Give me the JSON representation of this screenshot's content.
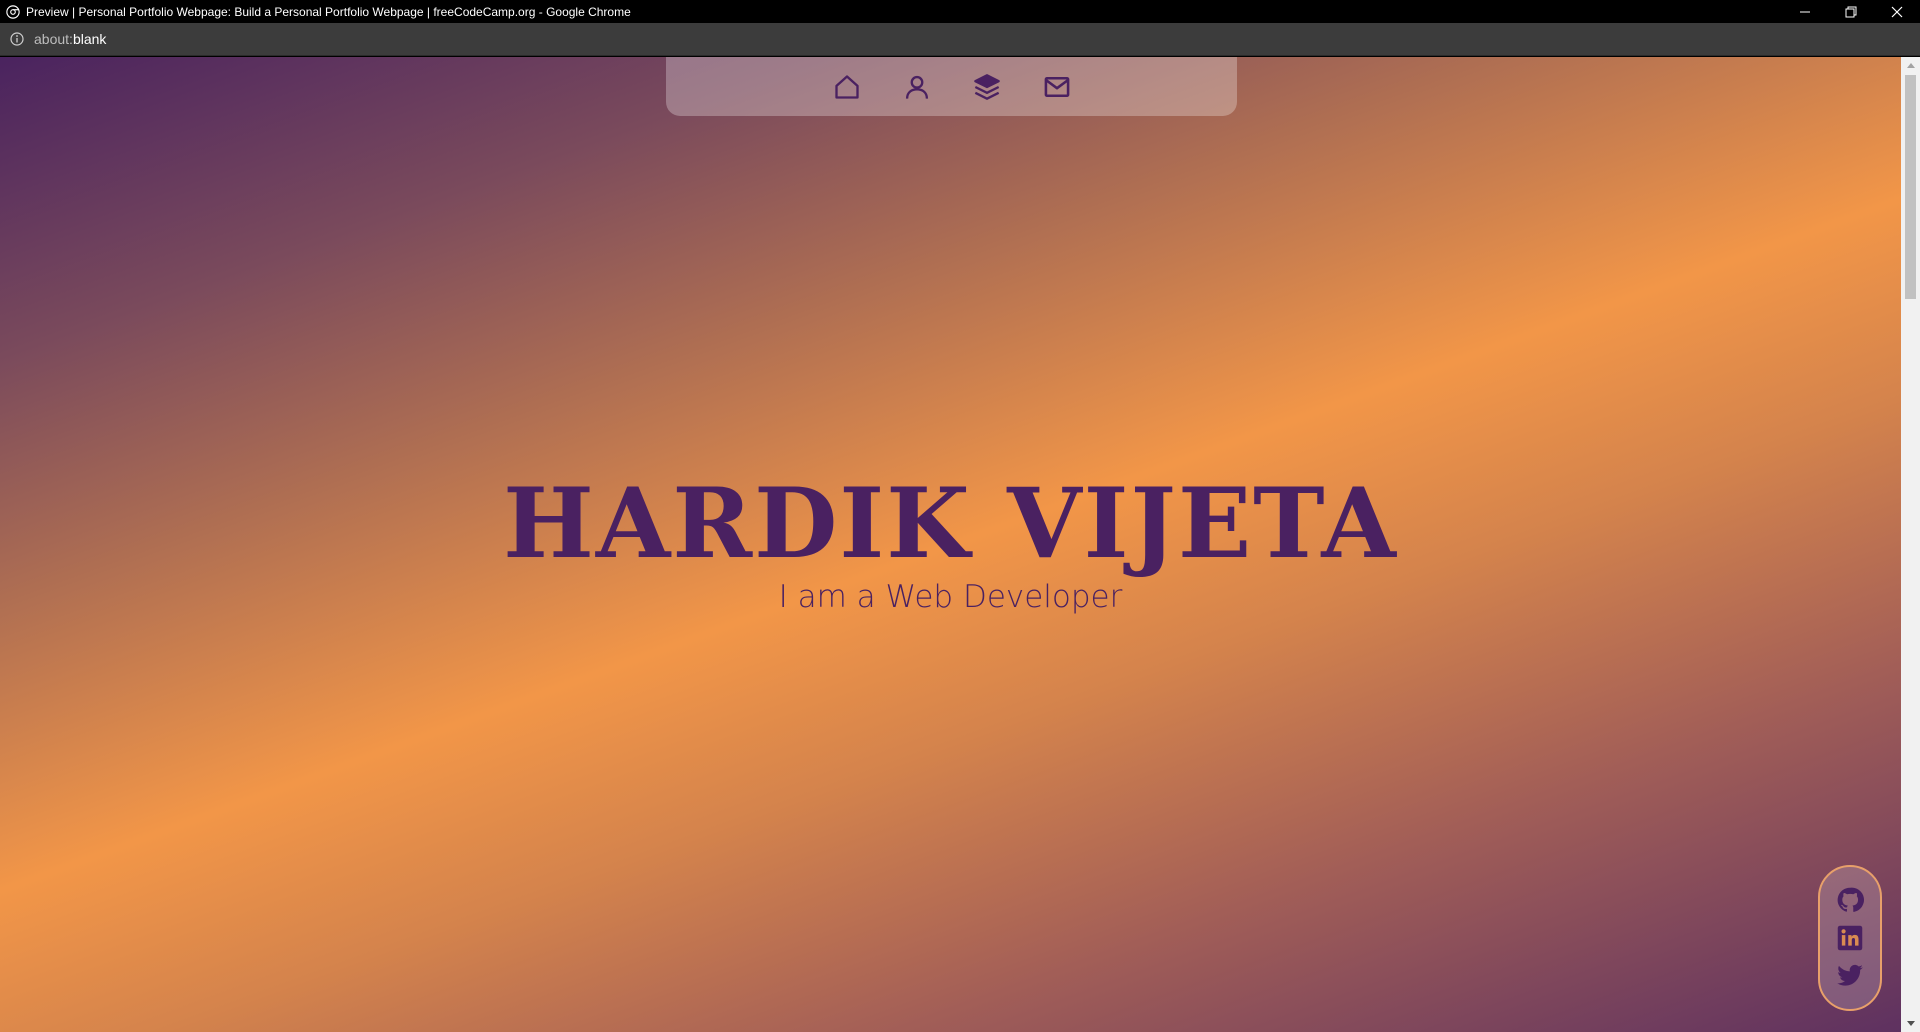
{
  "window": {
    "title": "Preview | Personal Portfolio Webpage: Build a Personal Portfolio Webpage | freeCodeCamp.org - Google Chrome"
  },
  "address": {
    "scheme": "about:",
    "host": "blank"
  },
  "nav": {
    "items": [
      {
        "icon": "home-icon"
      },
      {
        "icon": "user-icon"
      },
      {
        "icon": "layers-icon"
      },
      {
        "icon": "mail-icon"
      }
    ]
  },
  "hero": {
    "name": "HARDIK VIJETA",
    "subtitle": "I am a Web Developer"
  },
  "social": {
    "items": [
      {
        "icon": "github-icon"
      },
      {
        "icon": "linkedin-icon"
      },
      {
        "icon": "twitter-icon"
      }
    ]
  },
  "colors": {
    "text": "#4a2161",
    "gradient_start": "#4a235f",
    "gradient_mid": "#f29648",
    "gradient_end": "#5e3160"
  }
}
